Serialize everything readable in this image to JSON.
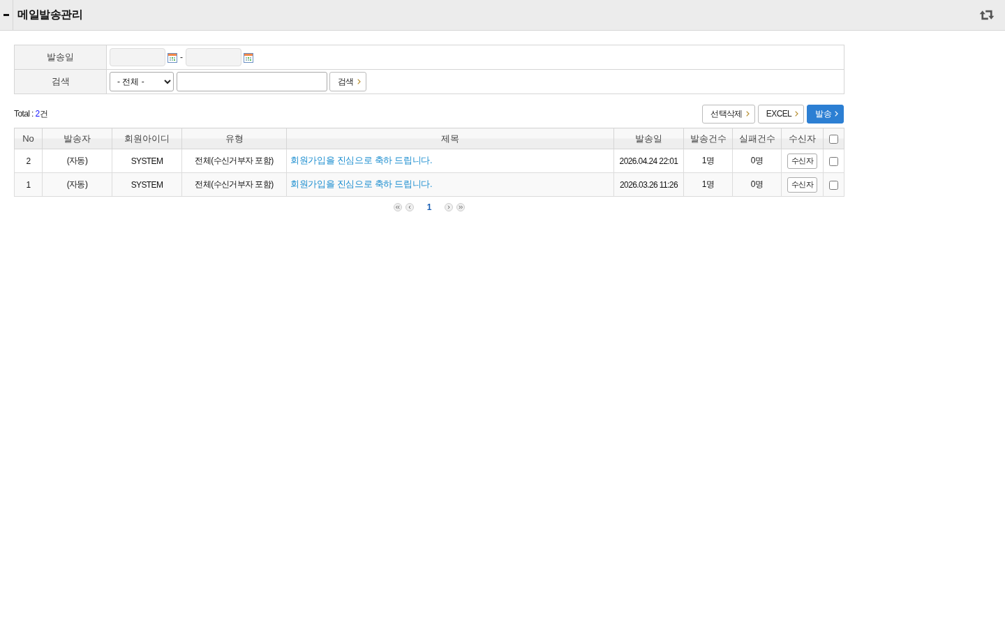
{
  "header": {
    "title": "메일발송관리"
  },
  "filter": {
    "date_label": "발송일",
    "date_separator": "-",
    "search_label": "검색",
    "search_select": {
      "value": "- 전체 -"
    },
    "search_button": "검색"
  },
  "total": {
    "label": "Total :",
    "count": "2",
    "unit": "건"
  },
  "actions": [
    {
      "label": "선택삭제",
      "kind": "default"
    },
    {
      "label": "EXCEL",
      "kind": "default"
    },
    {
      "label": "발송",
      "kind": "primary"
    }
  ],
  "table": {
    "columns": [
      "No",
      "발송자",
      "회원아이디",
      "유형",
      "제목",
      "발송일",
      "발송건수",
      "실패건수",
      "수신자"
    ],
    "select_all": {
      "checked": false
    },
    "rows": [
      {
        "no": "2",
        "sender": "(자동)",
        "member_id": "SYSTEM",
        "type": "전체(수신거부자 포함)",
        "subject": "회원가입을 진심으로 축하 드립니다.",
        "sent_at": "2026.04.24 22:01",
        "sent_count": "1명",
        "failed_count": "0명",
        "recipients_button": "수신자",
        "checked": false
      },
      {
        "no": "1",
        "sender": "(자동)",
        "member_id": "SYSTEM",
        "type": "전체(수신거부자 포함)",
        "subject": "회원가입을 진심으로 축하 드립니다.",
        "sent_at": "2026.03.26 11:26",
        "sent_count": "1명",
        "failed_count": "0명",
        "recipients_button": "수신자",
        "checked": false
      }
    ]
  },
  "pagination": {
    "pages": [
      {
        "label": "1",
        "selected": true
      }
    ]
  }
}
